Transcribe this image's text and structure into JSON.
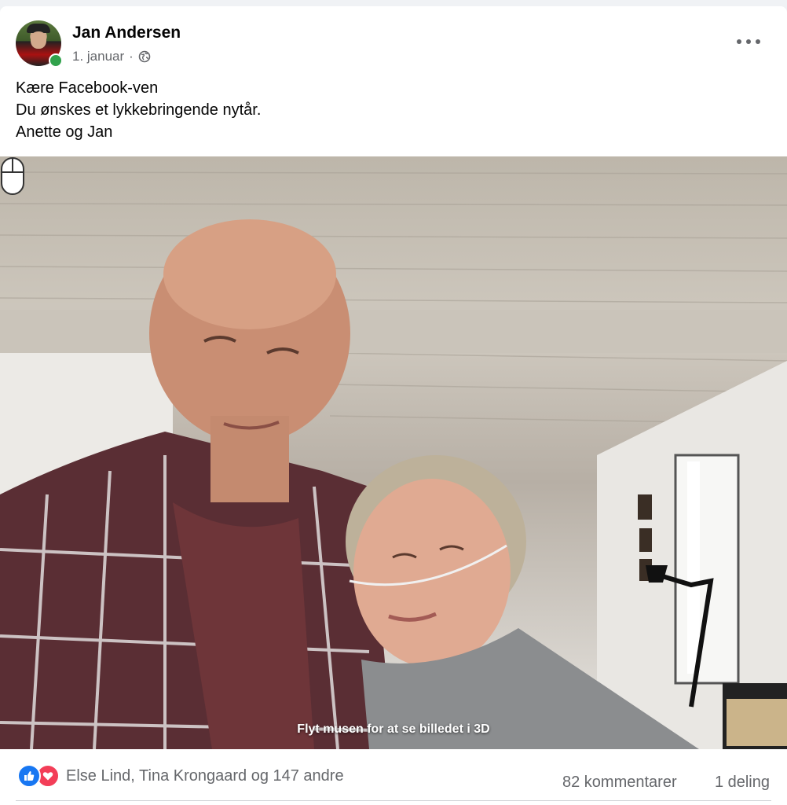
{
  "post": {
    "author": "Jan Andersen",
    "date": "1. januar",
    "separator": "·",
    "privacy_icon": "globe-icon",
    "menu_icon": "more-options-icon",
    "text_lines": [
      "Kære Facebook-ven",
      "Du ønskes et lykkebringende nytår.",
      "Anette og Jan"
    ]
  },
  "photo": {
    "hint_icon": "mouse-icon",
    "hint_text": "Flyt musen for at se billedet i 3D"
  },
  "footer": {
    "reaction_icons": [
      "like-icon",
      "love-icon"
    ],
    "reactors": "Else Lind, Tina Krongaard og 147 andre",
    "comments": "82 kommentarer",
    "shares": "1 deling"
  },
  "colors": {
    "like": "#1877f2",
    "love": "#f33e58",
    "online": "#31a24c",
    "secondary_text": "#65676b"
  }
}
